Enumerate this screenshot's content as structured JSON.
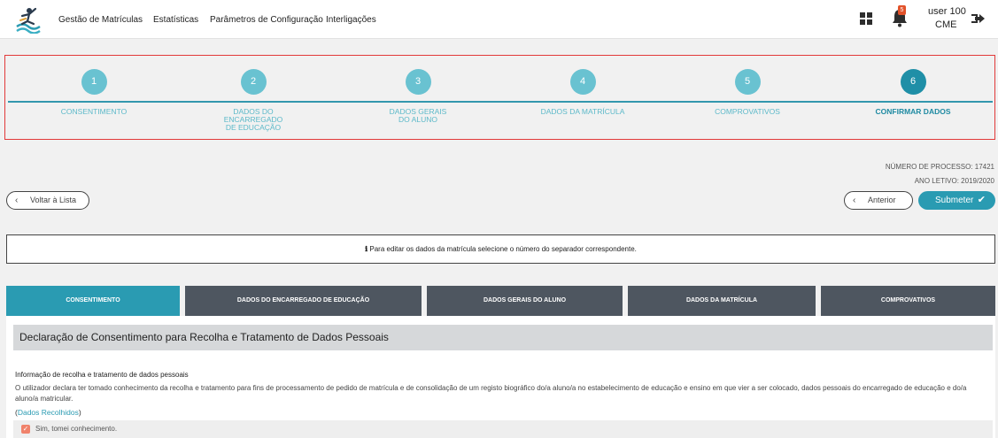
{
  "nav": {
    "items": [
      "Gestão de Matrículas",
      "Estatísticas",
      "Parâmetros de Configuração",
      "Interligações"
    ],
    "notification_count": "5",
    "user_name": "user 100",
    "user_org": "CME"
  },
  "stepper": {
    "steps": [
      {
        "number": "1",
        "label": "CONSENTIMENTO"
      },
      {
        "number": "2",
        "label": "DADOS DO ENCARREGADO DE EDUCAÇÃO"
      },
      {
        "number": "3",
        "label": "DADOS GERAIS DO ALUNO"
      },
      {
        "number": "4",
        "label": "DADOS DA MATRÍCULA"
      },
      {
        "number": "5",
        "label": "COMPROVATIVOS"
      },
      {
        "number": "6",
        "label": "CONFIRMAR DADOS"
      }
    ],
    "active_step": 6
  },
  "process": {
    "number_text": "NÚMERO DE PROCESSO: 17421",
    "year_text": "ANO LETIVO: 2019/2020"
  },
  "buttons": {
    "back_to_list": "Voltar à Lista",
    "previous": "Anterior",
    "submit": "Submeter"
  },
  "info": {
    "text": "Para editar os dados da matrícula selecione o número do separador correspondente."
  },
  "tabs": [
    "CONSENTIMENTO",
    "DADOS DO ENCARREGADO DE EDUCAÇÃO",
    "DADOS GERAIS DO ALUNO",
    "DADOS DA MATRÍCULA",
    "COMPROVATIVOS"
  ],
  "panel": {
    "header": "Declaração de Consentimento para Recolha e Tratamento de Dados Pessoais",
    "section_title": "Informação de recolha e tratamento de dados pessoais",
    "section_text": "O utilizador declara ter tomado conhecimento da recolha e tratamento para fins de processamento de pedido de matrícula e de consolidação de um registo biográfico do/a aluno/a no estabelecimento de educação e ensino em que vier a ser colocado, dados pessoais do encarregado de educação e do/a aluno/a matricular.",
    "dados_link": "Dados Recolhidos",
    "consent_label": "Sim, tomei conhecimento."
  },
  "colors": {
    "accent": "#2a9bb2",
    "step_inactive": "#69c2d1",
    "tab_inactive": "#4e5660",
    "highlight_border": "#e23a3a",
    "badge": "#e2522a"
  }
}
